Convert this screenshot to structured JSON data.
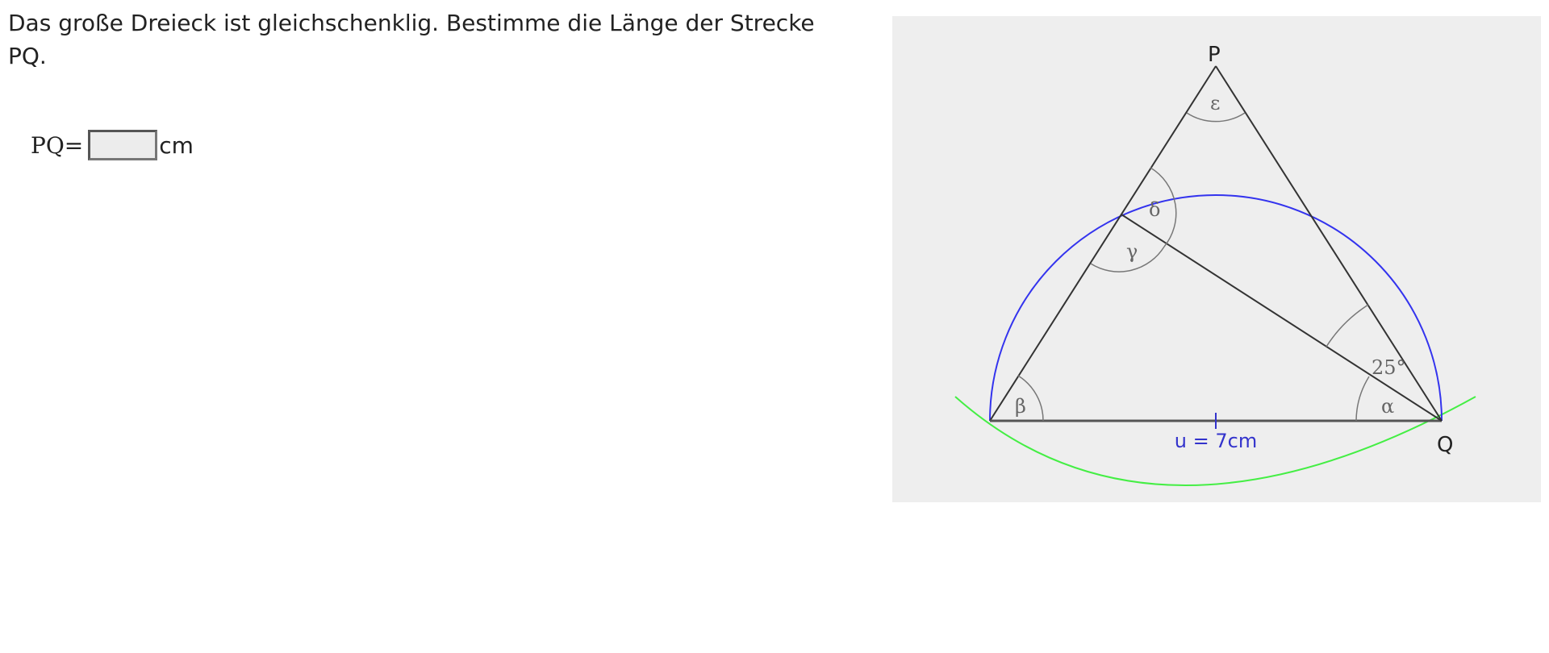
{
  "task": {
    "text": "Das große Dreieck ist gleichschenklig. Bestimme die Länge der Strecke PQ."
  },
  "answer": {
    "label": "PQ=",
    "value": "",
    "placeholder": "",
    "unit": "cm"
  },
  "figure": {
    "points": {
      "P": "P",
      "Q": "Q"
    },
    "angles": {
      "epsilon": "ε",
      "delta": "δ",
      "gamma": "γ",
      "beta": "β",
      "alpha": "α",
      "given": "25°"
    },
    "base_label": "u = 7cm",
    "colors": {
      "background": "#eeeeee",
      "lines": "#333333",
      "semicircle": "#3333ee",
      "arc": "#44ee44",
      "base_label": "#3333cc",
      "angle_arcs": "#777777"
    }
  }
}
